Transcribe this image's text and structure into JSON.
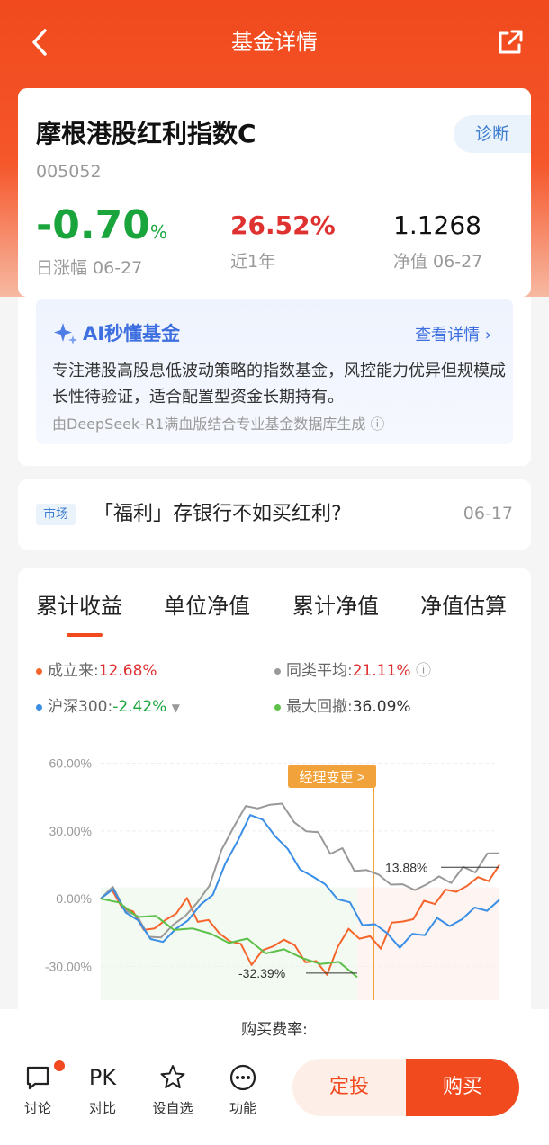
{
  "header": {
    "back_icon": "chevron-left-icon",
    "title": "基金详情",
    "share_icon": "share-icon"
  },
  "fund": {
    "name": "摩根港股红利指数C",
    "code": "005052",
    "diagnose": "诊断",
    "daily_change": "-0.70",
    "daily_change_unit": "%",
    "daily_label": "日涨幅 06-27",
    "year_return": "26.52%",
    "year_label": "近1年",
    "nav": "1.1268",
    "nav_label": "净值 06-27"
  },
  "ai": {
    "icon": "sparkle-icon",
    "title": "AI秒懂基金",
    "more": "查看详情 ›",
    "text": "专注港股高股息低波动策略的指数基金，风控能力优异但规模成长性待验证，适合配置型资金长期持有。",
    "source": "由DeepSeek-R1满血版结合专业基金数据库生成 ⓘ"
  },
  "news": {
    "tag": "市场",
    "title": "「福利」存银行不如买红利?",
    "date": "06-17"
  },
  "tabs": [
    "累计收益",
    "单位净值",
    "累计净值",
    "净值估算"
  ],
  "legend": {
    "since": "成立来:",
    "since_val": "12.68%",
    "avg": "同类平均:",
    "avg_val": "21.11%",
    "hs300": "沪深300:",
    "hs300_val": "-2.42%",
    "drawdown": "最大回撤:",
    "drawdown_val": "36.09%"
  },
  "colors": {
    "since": "#f5652b",
    "avg": "#999999",
    "hs300": "#3a8ee6",
    "drawdown": "#5cc04a"
  },
  "chart_data": {
    "type": "line",
    "yticks": [
      "60.00%",
      "30.00%",
      "0.00%",
      "-30.00%"
    ],
    "ylim": [
      -45,
      65
    ],
    "annotations": {
      "manager_change": "经理变更 >",
      "high": "13.88%",
      "low": "-32.39%"
    },
    "series": [
      {
        "name": "成立来",
        "values": [
          0,
          3,
          -2,
          -8,
          -12,
          -14,
          -10,
          -5,
          -2,
          -8,
          -11,
          -15,
          -18,
          -22,
          -27,
          -25,
          -20,
          -18,
          -22,
          -26,
          -30,
          -32,
          -22,
          -14,
          -16,
          -19,
          -20,
          -12,
          -10,
          -8,
          -3,
          0,
          2,
          4,
          6,
          8,
          10,
          12.68
        ]
      },
      {
        "name": "同类平均",
        "values": [
          0,
          4,
          -3,
          -10,
          -15,
          -18,
          -12,
          -6,
          -4,
          8,
          20,
          32,
          42,
          38,
          44,
          40,
          35,
          30,
          28,
          22,
          20,
          14,
          12,
          10,
          8,
          4,
          6,
          5,
          10,
          8,
          12,
          14,
          18,
          21.11
        ]
      },
      {
        "name": "沪深300",
        "values": [
          0,
          3,
          -4,
          -12,
          -16,
          -20,
          -14,
          -8,
          -5,
          4,
          14,
          26,
          38,
          33,
          30,
          20,
          14,
          10,
          5,
          2,
          -4,
          -10,
          -12,
          -16,
          -20,
          -18,
          -14,
          -10,
          -12,
          -8,
          -6,
          -3,
          -2.42
        ]
      },
      {
        "name": "最大回撤",
        "values": [
          0,
          -3,
          -6,
          -10,
          -12,
          -14,
          -16,
          -18,
          -20,
          -22,
          -24,
          -26,
          -28,
          -30,
          -32.39
        ]
      }
    ]
  },
  "fee": {
    "label": "购买费率:"
  },
  "bottom": {
    "discuss": "讨论",
    "pk": "PK",
    "compare": "对比",
    "fav": "设自选",
    "func": "功能",
    "invest": "定投",
    "buy": "购买"
  }
}
